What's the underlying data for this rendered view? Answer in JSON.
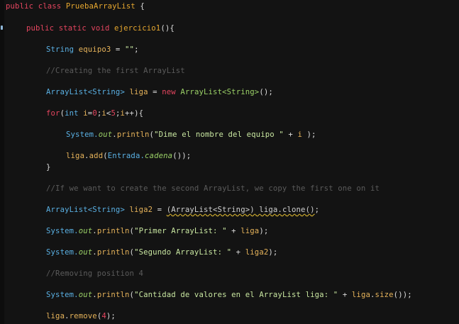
{
  "editor": {
    "lines": [
      {
        "tokens": [
          [
            "kw",
            "public class "
          ],
          [
            "fn",
            "PruebaArrayList"
          ],
          [
            "op",
            " {"
          ]
        ]
      },
      {
        "tokens": [
          [
            "kw",
            "public static void "
          ],
          [
            "fn",
            "ejercicio1"
          ],
          [
            "op",
            "(){"
          ]
        ]
      },
      {
        "tokens": [
          [
            "type",
            "String "
          ],
          [
            "var",
            "equipo3"
          ],
          [
            "op",
            " = "
          ],
          [
            "str",
            "\"\""
          ],
          [
            "op",
            ";"
          ]
        ]
      },
      {
        "tokens": [
          [
            "cmt",
            "//Creating the first ArrayList"
          ]
        ]
      },
      {
        "tokens": [
          [
            "type",
            "ArrayList<String> "
          ],
          [
            "var",
            "liga"
          ],
          [
            "op",
            " = "
          ],
          [
            "kw",
            "new "
          ],
          [
            "typeg",
            "ArrayList<String>"
          ],
          [
            "op",
            "();"
          ]
        ]
      },
      {
        "tokens": [
          [
            "kw",
            "for"
          ],
          [
            "op",
            "("
          ],
          [
            "type",
            "int "
          ],
          [
            "var",
            "i"
          ],
          [
            "op",
            "="
          ],
          [
            "num",
            "0"
          ],
          [
            "op",
            ";"
          ],
          [
            "var",
            "i"
          ],
          [
            "op",
            "<"
          ],
          [
            "num",
            "5"
          ],
          [
            "op",
            ";"
          ],
          [
            "var",
            "i"
          ],
          [
            "op",
            "++){"
          ]
        ]
      },
      {
        "tokens": [
          [
            "sys",
            "System."
          ],
          [
            "fld",
            "out"
          ],
          [
            "op",
            "."
          ],
          [
            "method",
            "println"
          ],
          [
            "op",
            "("
          ],
          [
            "str",
            "\"Dime el nombre del equipo \""
          ],
          [
            "op",
            " + "
          ],
          [
            "var",
            "i"
          ],
          [
            "op",
            " );"
          ]
        ]
      },
      {
        "tokens": [
          [
            "var",
            "liga"
          ],
          [
            "op",
            "."
          ],
          [
            "method",
            "add"
          ],
          [
            "op",
            "("
          ],
          [
            "sys",
            "Entrada."
          ],
          [
            "fld",
            "cadena"
          ],
          [
            "op",
            "());"
          ]
        ]
      },
      {
        "tokens": [
          [
            "op",
            "}"
          ]
        ]
      },
      {
        "tokens": [
          [
            "cmt",
            "//If we want to create the second ArrayList, we copy the first one on it"
          ]
        ]
      },
      {
        "tokens": [
          [
            "type",
            "ArrayList<String> "
          ],
          [
            "var",
            "liga2"
          ],
          [
            "op",
            " = "
          ],
          [
            "warn",
            "(ArrayList<String>) liga.clone()"
          ],
          [
            "op",
            ";"
          ]
        ]
      },
      {
        "tokens": [
          [
            "sys",
            "System."
          ],
          [
            "fld",
            "out"
          ],
          [
            "op",
            "."
          ],
          [
            "method",
            "println"
          ],
          [
            "op",
            "("
          ],
          [
            "str",
            "\"Primer ArrayList: \""
          ],
          [
            "op",
            " + "
          ],
          [
            "var",
            "liga"
          ],
          [
            "op",
            ");"
          ]
        ]
      },
      {
        "tokens": [
          [
            "sys",
            "System."
          ],
          [
            "fld",
            "out"
          ],
          [
            "op",
            "."
          ],
          [
            "method",
            "println"
          ],
          [
            "op",
            "("
          ],
          [
            "str",
            "\"Segundo ArrayList: \""
          ],
          [
            "op",
            " + "
          ],
          [
            "var",
            "liga2"
          ],
          [
            "op",
            ");"
          ]
        ]
      },
      {
        "tokens": [
          [
            "cmt",
            "//Removing position 4"
          ]
        ]
      },
      {
        "tokens": [
          [
            "sys",
            "System."
          ],
          [
            "fld",
            "out"
          ],
          [
            "op",
            "."
          ],
          [
            "method",
            "println"
          ],
          [
            "op",
            "("
          ],
          [
            "str",
            "\"Cantidad de valores en el ArrayList liga: \""
          ],
          [
            "op",
            " + "
          ],
          [
            "var",
            "liga"
          ],
          [
            "op",
            "."
          ],
          [
            "method",
            "size"
          ],
          [
            "op",
            "());"
          ]
        ]
      },
      {
        "tokens": [
          [
            "var",
            "liga"
          ],
          [
            "op",
            "."
          ],
          [
            "method",
            "remove"
          ],
          [
            "op",
            "("
          ],
          [
            "num",
            "4"
          ],
          [
            "op",
            ");"
          ]
        ]
      }
    ]
  },
  "colors": {
    "background": "#131313",
    "keyword": "#e5455f",
    "type": "#5ab0e3",
    "string": "#c8e6a0",
    "comment": "#5b5b5b",
    "variable": "#e6b35a"
  }
}
